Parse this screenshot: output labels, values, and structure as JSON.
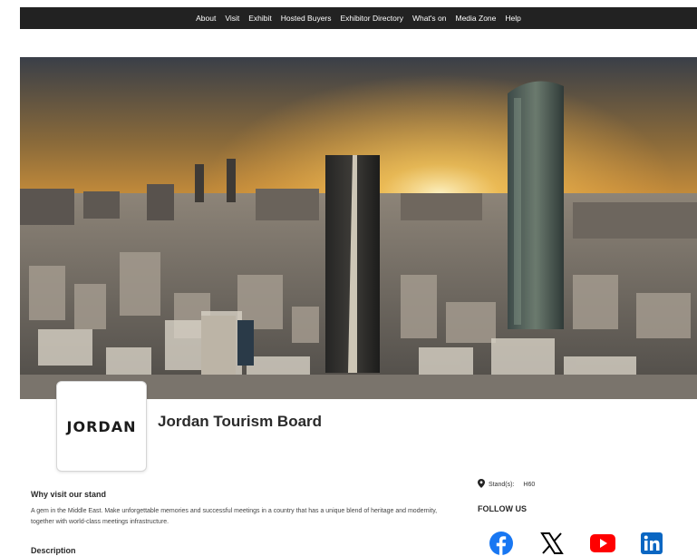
{
  "nav": {
    "items": [
      "About",
      "Visit",
      "Exhibit",
      "Hosted Buyers",
      "Exhibitor Directory",
      "What's on",
      "Media Zone",
      "Help"
    ]
  },
  "exhibitor": {
    "logo_text": "JORDAN",
    "name": "Jordan Tourism Board"
  },
  "why_visit": {
    "heading": "Why visit our stand",
    "text": "A gem in the Middle East. Make unforgettable memories and successful meetings in a country that has a unique blend of heritage and modernity, together with world-class meetings infrastructure."
  },
  "description": {
    "heading": "Description"
  },
  "stand": {
    "label": "Stand(s):",
    "value": "H60"
  },
  "follow": {
    "heading": "FOLLOW US",
    "icons": [
      "facebook-icon",
      "x-icon",
      "youtube-icon",
      "linkedin-icon"
    ]
  },
  "colors": {
    "navbar": "#222222",
    "facebook": "#1877F2",
    "youtube": "#FF0000",
    "linkedin": "#0A66C2"
  }
}
